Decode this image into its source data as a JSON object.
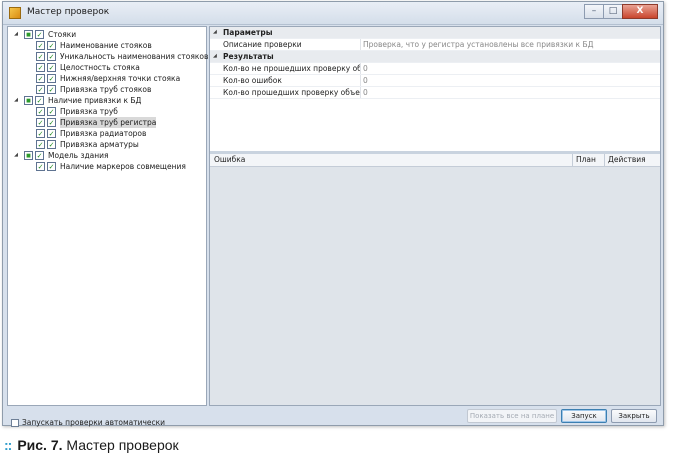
{
  "window": {
    "title": "Мастер проверок",
    "controls": [
      "–",
      "□",
      "X"
    ]
  },
  "tree": [
    {
      "label": "Стояки",
      "level": 0,
      "checked": true,
      "expanded": true,
      "selected": false
    },
    {
      "label": "Наименование стояков",
      "level": 1,
      "checked": true,
      "selected": false
    },
    {
      "label": "Уникальность наименования стояков",
      "level": 1,
      "checked": true,
      "selected": false
    },
    {
      "label": "Целостность стояка",
      "level": 1,
      "checked": true,
      "selected": false
    },
    {
      "label": "Нижняя/верхняя точки стояка",
      "level": 1,
      "checked": true,
      "selected": false
    },
    {
      "label": "Привязка труб стояков",
      "level": 1,
      "checked": true,
      "selected": false
    },
    {
      "label": "Наличие привязки к БД",
      "level": 0,
      "checked": true,
      "expanded": true,
      "selected": false
    },
    {
      "label": "Привязка труб",
      "level": 1,
      "checked": true,
      "selected": false
    },
    {
      "label": "Привязка труб регистра",
      "level": 1,
      "checked": true,
      "selected": true
    },
    {
      "label": "Привязка радиаторов",
      "level": 1,
      "checked": true,
      "selected": false
    },
    {
      "label": "Привязка арматуры",
      "level": 1,
      "checked": true,
      "selected": false
    },
    {
      "label": "Модель здания",
      "level": 0,
      "checked": true,
      "expanded": true,
      "selected": false
    },
    {
      "label": "Наличие маркеров совмещения",
      "level": 1,
      "checked": true,
      "selected": false
    }
  ],
  "properties": {
    "params_title": "Параметры",
    "params": [
      {
        "name": "Описание проверки",
        "value": "Проверка, что у регистра установлены все привязки к БД"
      }
    ],
    "results_title": "Результаты",
    "results": [
      {
        "name": "Кол-во не прошедших проверку об...",
        "value": "0"
      },
      {
        "name": "Кол-во ошибок",
        "value": "0"
      },
      {
        "name": "Кол-во прошедших проверку объек...",
        "value": "0"
      }
    ]
  },
  "errors_table": {
    "columns": [
      "Ошибка",
      "План",
      "Действия"
    ]
  },
  "footer": {
    "auto_run_label": "Запускать проверки автоматически",
    "show_all_label": "Показать все на плане",
    "run_label": "Запуск",
    "close_label": "Закрыть"
  },
  "caption": {
    "dots": "::",
    "fig": "Рис. 7.",
    "text": "Мастер проверок"
  }
}
